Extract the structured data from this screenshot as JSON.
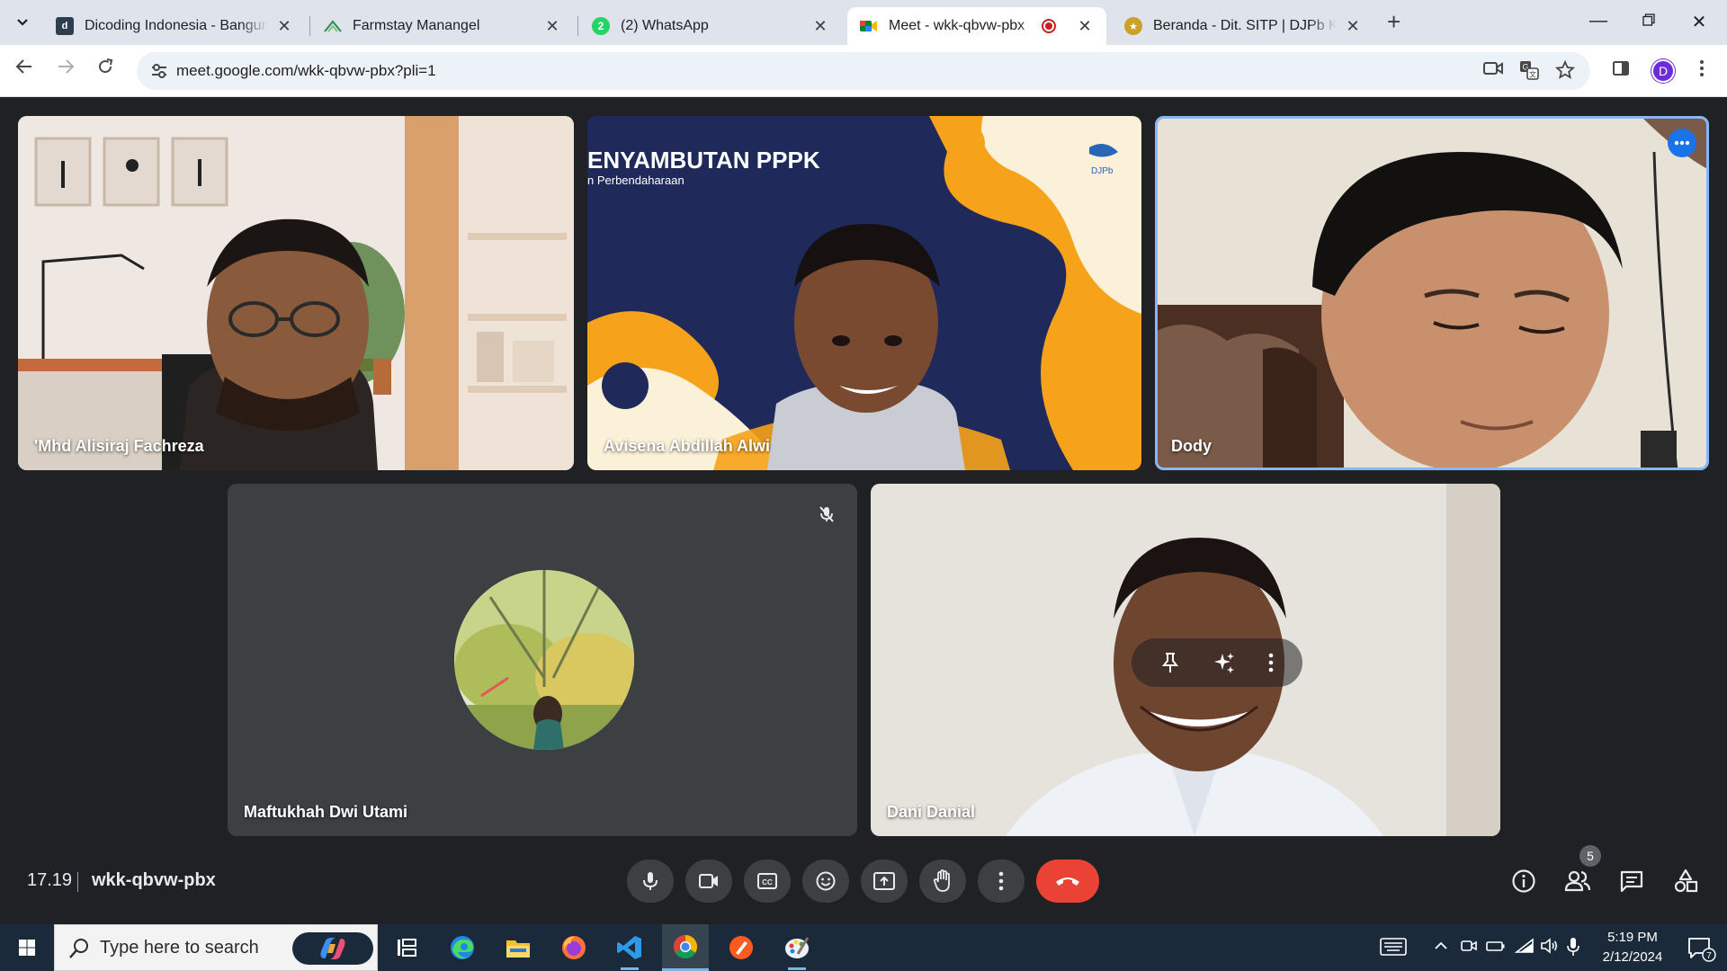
{
  "browser": {
    "tabs": [
      {
        "title": "Dicoding Indonesia - Bangun Karir",
        "favicon": "dicoding-icon",
        "active": false
      },
      {
        "title": "Farmstay Manangel",
        "favicon": "farmstay-icon",
        "active": false
      },
      {
        "title": "(2) WhatsApp",
        "favicon": "whatsapp-icon",
        "badge": "2",
        "active": false
      },
      {
        "title": "Meet - wkk-qbvw-pbx",
        "favicon": "meet-icon",
        "recording": true,
        "active": true
      },
      {
        "title": "Beranda - Dit. SITP | DJPb Kemenkeu",
        "favicon": "djpb-icon",
        "active": false
      }
    ],
    "url": "meet.google.com/wkk-qbvw-pbx?pli=1",
    "profile_initial": "D",
    "colors": {
      "tabstrip": "#dfe3eb",
      "omnibox": "#edf1f8",
      "profile": "#6c2bd9"
    }
  },
  "meet": {
    "participants": [
      {
        "name": "'Mhd Alisiraj Fachreza"
      },
      {
        "name": "Avisena Abdillah Alwi",
        "background_text_title": "ENYAMBUTAN PPPK",
        "background_text_sub": "n Perbendaharaan",
        "logo_text": "DJPb"
      },
      {
        "name": "Dody",
        "speaking": true
      },
      {
        "name": "Maftukhah Dwi Utami",
        "muted": true
      },
      {
        "name": "Dani Danial"
      }
    ],
    "time": "17.19",
    "meeting_code": "wkk-qbvw-pbx",
    "people_count": "5",
    "controls": [
      "mic-icon",
      "camera-icon",
      "captions-icon",
      "emoji-icon",
      "present-icon",
      "raise-hand-icon",
      "more-options-icon",
      "leave-call-icon"
    ],
    "side_controls": [
      "info-icon",
      "people-icon",
      "chat-icon",
      "activities-icon"
    ],
    "colors": {
      "stage": "#202124",
      "control": "#3c4043",
      "leave": "#ea4335",
      "speaking_outline": "#8ab4f8",
      "more_button": "#1a73e8"
    }
  },
  "taskbar": {
    "search_placeholder": "Type here to search",
    "apps": [
      "task-view-icon",
      "edge-icon",
      "file-explorer-icon",
      "firefox-icon",
      "vscode-icon",
      "chrome-icon",
      "sketch-app-icon",
      "paint-app-icon"
    ],
    "time": "5:19 PM",
    "date": "2/12/2024",
    "notification_count": "7"
  }
}
